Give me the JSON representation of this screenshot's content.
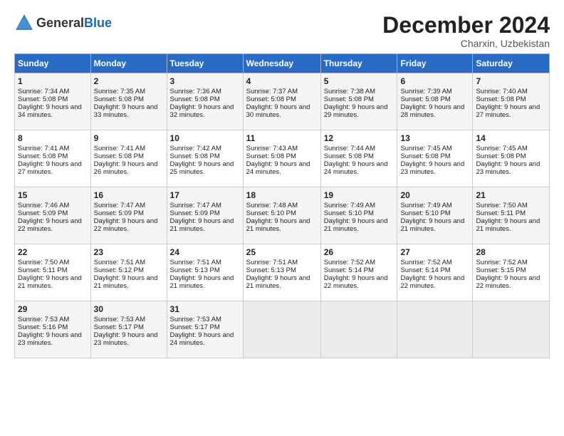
{
  "logo": {
    "text_general": "General",
    "text_blue": "Blue"
  },
  "title": "December 2024",
  "location": "Charxin, Uzbekistan",
  "days_of_week": [
    "Sunday",
    "Monday",
    "Tuesday",
    "Wednesday",
    "Thursday",
    "Friday",
    "Saturday"
  ],
  "weeks": [
    [
      {
        "day": "1",
        "sunrise": "Sunrise: 7:34 AM",
        "sunset": "Sunset: 5:08 PM",
        "daylight": "Daylight: 9 hours and 34 minutes."
      },
      {
        "day": "2",
        "sunrise": "Sunrise: 7:35 AM",
        "sunset": "Sunset: 5:08 PM",
        "daylight": "Daylight: 9 hours and 33 minutes."
      },
      {
        "day": "3",
        "sunrise": "Sunrise: 7:36 AM",
        "sunset": "Sunset: 5:08 PM",
        "daylight": "Daylight: 9 hours and 32 minutes."
      },
      {
        "day": "4",
        "sunrise": "Sunrise: 7:37 AM",
        "sunset": "Sunset: 5:08 PM",
        "daylight": "Daylight: 9 hours and 30 minutes."
      },
      {
        "day": "5",
        "sunrise": "Sunrise: 7:38 AM",
        "sunset": "Sunset: 5:08 PM",
        "daylight": "Daylight: 9 hours and 29 minutes."
      },
      {
        "day": "6",
        "sunrise": "Sunrise: 7:39 AM",
        "sunset": "Sunset: 5:08 PM",
        "daylight": "Daylight: 9 hours and 28 minutes."
      },
      {
        "day": "7",
        "sunrise": "Sunrise: 7:40 AM",
        "sunset": "Sunset: 5:08 PM",
        "daylight": "Daylight: 9 hours and 27 minutes."
      }
    ],
    [
      {
        "day": "8",
        "sunrise": "Sunrise: 7:41 AM",
        "sunset": "Sunset: 5:08 PM",
        "daylight": "Daylight: 9 hours and 27 minutes."
      },
      {
        "day": "9",
        "sunrise": "Sunrise: 7:41 AM",
        "sunset": "Sunset: 5:08 PM",
        "daylight": "Daylight: 9 hours and 26 minutes."
      },
      {
        "day": "10",
        "sunrise": "Sunrise: 7:42 AM",
        "sunset": "Sunset: 5:08 PM",
        "daylight": "Daylight: 9 hours and 25 minutes."
      },
      {
        "day": "11",
        "sunrise": "Sunrise: 7:43 AM",
        "sunset": "Sunset: 5:08 PM",
        "daylight": "Daylight: 9 hours and 24 minutes."
      },
      {
        "day": "12",
        "sunrise": "Sunrise: 7:44 AM",
        "sunset": "Sunset: 5:08 PM",
        "daylight": "Daylight: 9 hours and 24 minutes."
      },
      {
        "day": "13",
        "sunrise": "Sunrise: 7:45 AM",
        "sunset": "Sunset: 5:08 PM",
        "daylight": "Daylight: 9 hours and 23 minutes."
      },
      {
        "day": "14",
        "sunrise": "Sunrise: 7:45 AM",
        "sunset": "Sunset: 5:08 PM",
        "daylight": "Daylight: 9 hours and 23 minutes."
      }
    ],
    [
      {
        "day": "15",
        "sunrise": "Sunrise: 7:46 AM",
        "sunset": "Sunset: 5:09 PM",
        "daylight": "Daylight: 9 hours and 22 minutes."
      },
      {
        "day": "16",
        "sunrise": "Sunrise: 7:47 AM",
        "sunset": "Sunset: 5:09 PM",
        "daylight": "Daylight: 9 hours and 22 minutes."
      },
      {
        "day": "17",
        "sunrise": "Sunrise: 7:47 AM",
        "sunset": "Sunset: 5:09 PM",
        "daylight": "Daylight: 9 hours and 21 minutes."
      },
      {
        "day": "18",
        "sunrise": "Sunrise: 7:48 AM",
        "sunset": "Sunset: 5:10 PM",
        "daylight": "Daylight: 9 hours and 21 minutes."
      },
      {
        "day": "19",
        "sunrise": "Sunrise: 7:49 AM",
        "sunset": "Sunset: 5:10 PM",
        "daylight": "Daylight: 9 hours and 21 minutes."
      },
      {
        "day": "20",
        "sunrise": "Sunrise: 7:49 AM",
        "sunset": "Sunset: 5:10 PM",
        "daylight": "Daylight: 9 hours and 21 minutes."
      },
      {
        "day": "21",
        "sunrise": "Sunrise: 7:50 AM",
        "sunset": "Sunset: 5:11 PM",
        "daylight": "Daylight: 9 hours and 21 minutes."
      }
    ],
    [
      {
        "day": "22",
        "sunrise": "Sunrise: 7:50 AM",
        "sunset": "Sunset: 5:11 PM",
        "daylight": "Daylight: 9 hours and 21 minutes."
      },
      {
        "day": "23",
        "sunrise": "Sunrise: 7:51 AM",
        "sunset": "Sunset: 5:12 PM",
        "daylight": "Daylight: 9 hours and 21 minutes."
      },
      {
        "day": "24",
        "sunrise": "Sunrise: 7:51 AM",
        "sunset": "Sunset: 5:13 PM",
        "daylight": "Daylight: 9 hours and 21 minutes."
      },
      {
        "day": "25",
        "sunrise": "Sunrise: 7:51 AM",
        "sunset": "Sunset: 5:13 PM",
        "daylight": "Daylight: 9 hours and 21 minutes."
      },
      {
        "day": "26",
        "sunrise": "Sunrise: 7:52 AM",
        "sunset": "Sunset: 5:14 PM",
        "daylight": "Daylight: 9 hours and 22 minutes."
      },
      {
        "day": "27",
        "sunrise": "Sunrise: 7:52 AM",
        "sunset": "Sunset: 5:14 PM",
        "daylight": "Daylight: 9 hours and 22 minutes."
      },
      {
        "day": "28",
        "sunrise": "Sunrise: 7:52 AM",
        "sunset": "Sunset: 5:15 PM",
        "daylight": "Daylight: 9 hours and 22 minutes."
      }
    ],
    [
      {
        "day": "29",
        "sunrise": "Sunrise: 7:53 AM",
        "sunset": "Sunset: 5:16 PM",
        "daylight": "Daylight: 9 hours and 23 minutes."
      },
      {
        "day": "30",
        "sunrise": "Sunrise: 7:53 AM",
        "sunset": "Sunset: 5:17 PM",
        "daylight": "Daylight: 9 hours and 23 minutes."
      },
      {
        "day": "31",
        "sunrise": "Sunrise: 7:53 AM",
        "sunset": "Sunset: 5:17 PM",
        "daylight": "Daylight: 9 hours and 24 minutes."
      },
      null,
      null,
      null,
      null
    ]
  ]
}
